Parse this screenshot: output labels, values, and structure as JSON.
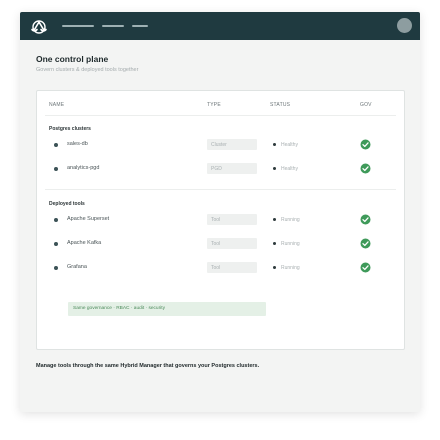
{
  "hero": {
    "title": "One control plane",
    "subtitle": "Govern clusters & deployed tools together"
  },
  "table": {
    "headers": [
      "NAME",
      "TYPE",
      "STATUS",
      "GOV"
    ],
    "sections": [
      {
        "title": "Postgres clusters",
        "rows": [
          {
            "name": "sales-db",
            "type": "Cluster",
            "status": "Healthy",
            "governed": true
          },
          {
            "name": "analytics-pgd",
            "type": "PGD",
            "status": "Healthy",
            "governed": true
          }
        ]
      },
      {
        "title": "Deployed tools",
        "rows": [
          {
            "name": "Apache Superset",
            "type": "Tool",
            "status": "Running",
            "governed": true
          },
          {
            "name": "Apache Kafka",
            "type": "Tool",
            "status": "Running",
            "governed": true
          },
          {
            "name": "Grafana",
            "type": "Tool",
            "status": "Running",
            "governed": true
          }
        ]
      }
    ],
    "banner": "Same governance · RBAC · audit · security"
  },
  "caption": "Manage tools through the same Hybrid Manager that governs your Postgres clusters.",
  "icons": {
    "logo": "infinity-cloud-logo-icon",
    "gov": "check-circle-icon",
    "avatar": "user-avatar"
  },
  "colors": {
    "topbar": "#1f3a40",
    "accent_green": "#3f9a5a",
    "banner_bg": "#e4f0e6"
  }
}
